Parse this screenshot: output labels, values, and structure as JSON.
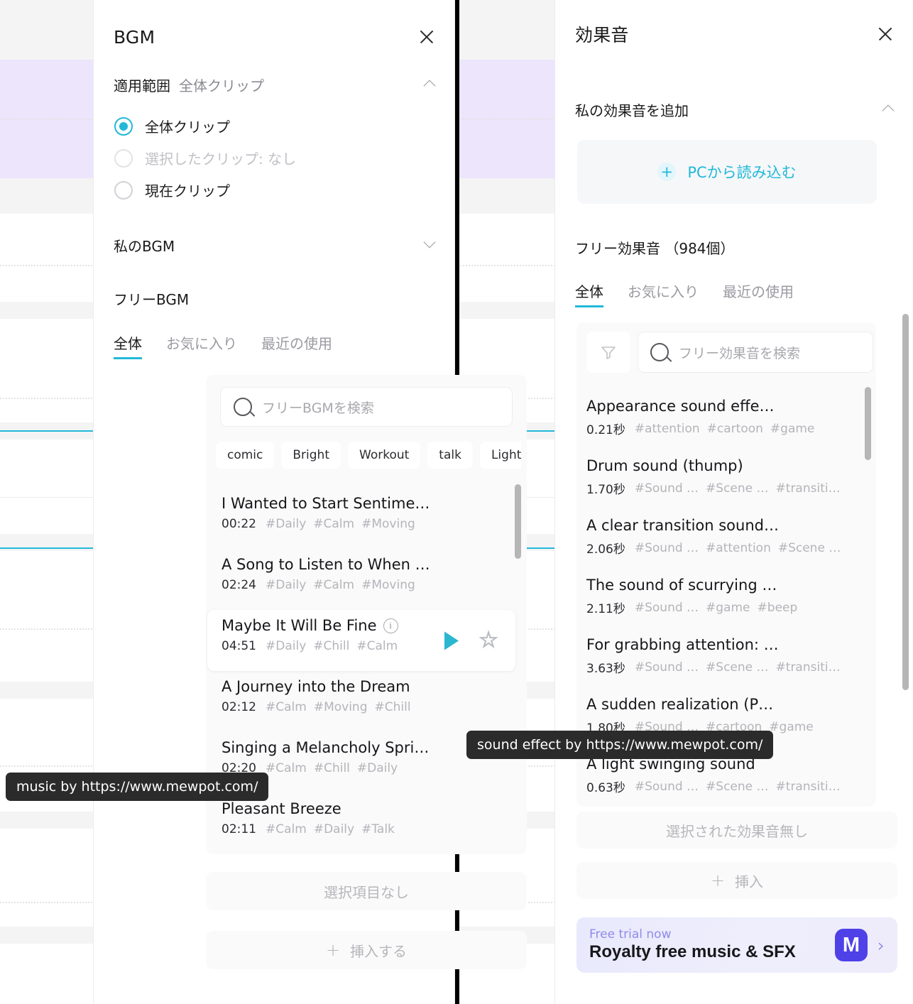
{
  "background": {
    "playhead_color": "#000000",
    "clip_color": "#ece5fb",
    "accent_color": "#21b9d8"
  },
  "bgm_panel": {
    "title": "BGM",
    "close_icon": "close-icon",
    "scope": {
      "label": "適用範囲",
      "value": "全体クリップ",
      "chevron": "chevron-up-icon",
      "options": [
        {
          "label": "全体クリップ",
          "selected": true,
          "disabled": false
        },
        {
          "label": "選択したクリップ: なし",
          "selected": false,
          "disabled": true
        },
        {
          "label": "現在クリップ",
          "selected": false,
          "disabled": false
        }
      ]
    },
    "my_bgm": {
      "label": "私のBGM",
      "chevron": "chevron-down-icon"
    },
    "free_bgm": {
      "label": "フリーBGM",
      "tabs": [
        {
          "label": "全体",
          "active": true
        },
        {
          "label": "お気に入り",
          "active": false
        },
        {
          "label": "最近の使用",
          "active": false
        }
      ],
      "search_placeholder": "フリーBGMを検索",
      "search_value": "",
      "search_icon": "search-icon",
      "chips": [
        "comic",
        "Bright",
        "Workout",
        "talk",
        "Light"
      ],
      "chips_next_icon": "chevron-right-icon",
      "tracks": [
        {
          "name": "I Wanted to Start Sentime…",
          "duration": "00:22",
          "tags": [
            "#Daily",
            "#Calm",
            "#Moving"
          ],
          "selected": false
        },
        {
          "name": "A Song to Listen to When …",
          "duration": "02:24",
          "tags": [
            "#Daily",
            "#Calm",
            "#Moving"
          ],
          "selected": false
        },
        {
          "name": "Maybe It Will Be Fine",
          "duration": "04:51",
          "tags": [
            "#Daily",
            "#Chill",
            "#Calm"
          ],
          "selected": true,
          "has_info": true,
          "play_icon": "play-icon",
          "favorite_icon": "star-outline-icon"
        },
        {
          "name": "A Journey into the Dream",
          "duration": "02:12",
          "tags": [
            "#Calm",
            "#Moving",
            "#Chill"
          ],
          "selected": false
        },
        {
          "name": "Singing a Melancholy Spri…",
          "duration": "02:20",
          "tags": [
            "#Calm",
            "#Chill",
            "#Daily"
          ],
          "selected": false
        },
        {
          "name": "Pleasant Breeze",
          "duration": "02:11",
          "tags": [
            "#Calm",
            "#Daily",
            "#Talk"
          ],
          "selected": false
        }
      ]
    },
    "no_selection_label": "選択項目なし",
    "insert_label": "挿入する",
    "insert_plus_icon": "plus-icon",
    "tooltip": "music by https://www.mewpot.com/"
  },
  "sfx_panel": {
    "title": "効果音",
    "close_icon": "close-icon",
    "add_my_sfx": {
      "label": "私の効果音を追加",
      "chevron": "chevron-up-icon",
      "import_label": "PCから読み込む",
      "import_icon": "plus-circle-icon"
    },
    "free_sfx": {
      "label": "フリー効果音 （984個）",
      "tabs": [
        {
          "label": "全体",
          "active": true
        },
        {
          "label": "お気に入り",
          "active": false
        },
        {
          "label": "最近の使用",
          "active": false
        }
      ],
      "filter_icon": "filter-icon",
      "search_placeholder": "フリー効果音を検索",
      "search_value": "",
      "search_icon": "search-icon",
      "items": [
        {
          "name": "Appearance sound effe…",
          "duration": "0.21秒",
          "tags": [
            "#attention",
            "#cartoon",
            "#game"
          ]
        },
        {
          "name": "Drum sound (thump)",
          "duration": "1.70秒",
          "tags": [
            "#Sound …",
            "#Scene …",
            "#transiti…"
          ]
        },
        {
          "name": "A clear transition sound…",
          "duration": "2.06秒",
          "tags": [
            "#Sound …",
            "#attention",
            "#Scene …"
          ]
        },
        {
          "name": "The sound of scurrying …",
          "duration": "2.11秒",
          "tags": [
            "#Sound …",
            "#game",
            "#beep"
          ]
        },
        {
          "name": "For grabbing attention: …",
          "duration": "3.63秒",
          "tags": [
            "#Sound …",
            "#Scene …",
            "#transiti…"
          ]
        },
        {
          "name": "A sudden realization (P…",
          "duration": "1.80秒",
          "tags": [
            "#Sound …",
            "#cartoon",
            "#game"
          ]
        },
        {
          "name": "A light swinging sound",
          "duration": "0.63秒",
          "tags": [
            "#Sound …",
            "#Scene …",
            "#transiti…"
          ]
        }
      ]
    },
    "no_selection_label": "選択された効果音無し",
    "insert_label": "挿入",
    "insert_plus_icon": "plus-icon",
    "promo": {
      "small": "Free trial now",
      "big": "Royalty free music & SFX",
      "logo": "M",
      "chevron": "chevron-right-icon"
    },
    "tooltip": "sound effect by https://www.mewpot.com/"
  }
}
